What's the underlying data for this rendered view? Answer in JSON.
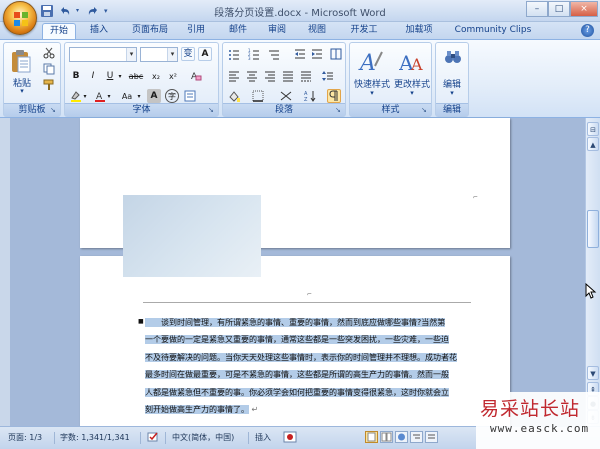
{
  "window": {
    "title": "段落分页设置.docx - Microsoft Word",
    "controls": {
      "minimize": "–",
      "maximize": "□",
      "close": "×"
    }
  },
  "qat": {
    "icons": [
      "save-icon",
      "undo-icon",
      "redo-icon",
      "customize-icon"
    ]
  },
  "tabs": [
    {
      "label": "开始",
      "active": true
    },
    {
      "label": "插入"
    },
    {
      "label": "页面布局"
    },
    {
      "label": "引用"
    },
    {
      "label": "邮件"
    },
    {
      "label": "审阅"
    },
    {
      "label": "视图"
    },
    {
      "label": "开发工具"
    },
    {
      "label": "加载项"
    },
    {
      "label": "Community Clips"
    }
  ],
  "ribbon": {
    "clipboard": {
      "label": "剪贴板",
      "paste": "粘贴"
    },
    "font": {
      "label": "字体",
      "font_name": "",
      "font_size": "",
      "wen": "变",
      "A": "A",
      "bold": "B",
      "italic": "I",
      "underline": "U",
      "strike": "abc",
      "sub": "x₂",
      "sup": "x²",
      "aa": "Aa",
      "shade": "A",
      "enclose": "字"
    },
    "paragraph": {
      "label": "段落"
    },
    "styles": {
      "label": "样式",
      "quick_styles": "快速样式",
      "change_styles": "更改样式"
    },
    "editing": {
      "label": "编辑",
      "edit": "编辑"
    }
  },
  "document": {
    "paragraph_lines": [
      "谈到时间管理，有所谓紧急的事情、重要的事情，然而到底应做哪些事情?当然第",
      "一个要做的一定是紧急又重要的事情，通常这些都是一些突发困扰，一些灾难，一些迫",
      "不及待要解决的问题。当你天天处理这些事情时，表示你的时间管理并不理想。成功者花",
      "最多时间在做最重要，可是不紧急的事情，这些都是所谓的高生产力的事情。然而一般",
      "人都是做紧急但不重要的事。你必须学会如何把重要的事情变得很紧急，这时你就会立",
      "刻开始做高生产力的事情了。"
    ]
  },
  "status": {
    "page": "页面: 1/3",
    "words": "字数: 1,341/1,341",
    "language": "中文(简体，中国)",
    "mode": "插入"
  },
  "watermark": {
    "cn": "易采站长站",
    "en": "www.easck.com"
  },
  "colors": {
    "accent": "#15428b",
    "ribbon_border": "#8db2e3",
    "highlight": "#b3cce8",
    "watermark_red": "#c0282f"
  }
}
